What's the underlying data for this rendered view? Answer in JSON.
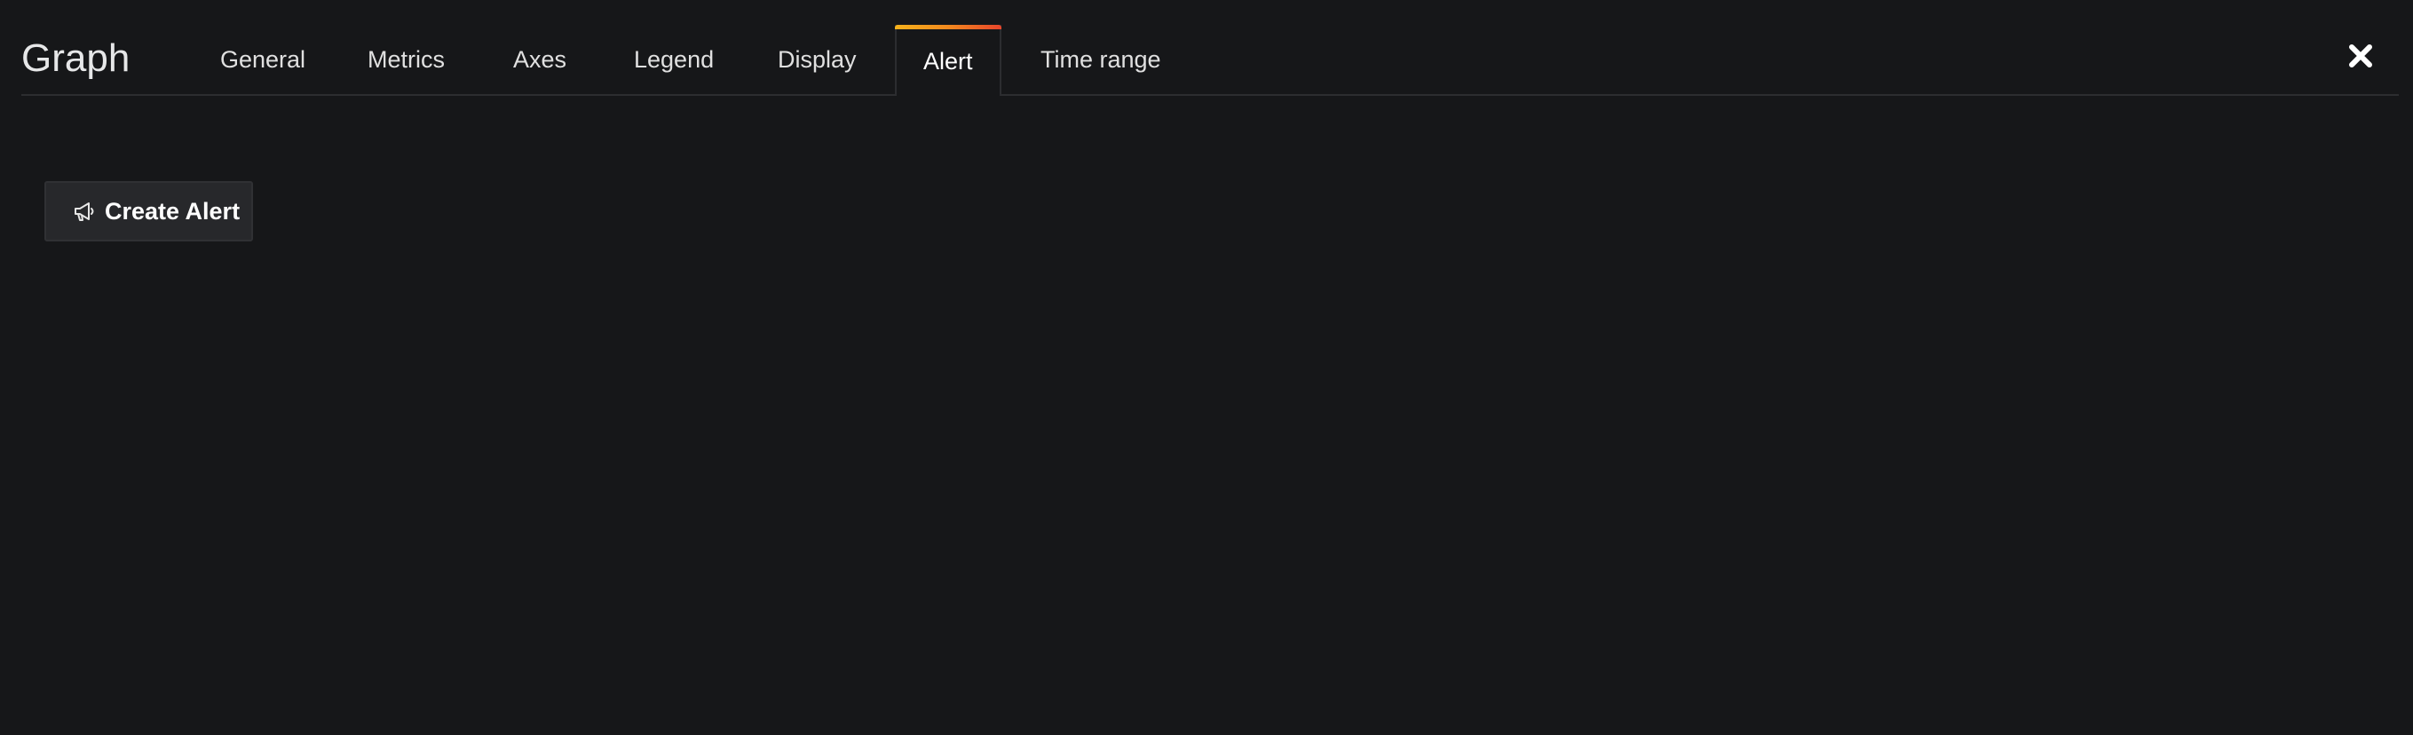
{
  "header": {
    "title": "Graph",
    "close_icon": "close-icon"
  },
  "tabs": [
    {
      "label": "General",
      "active": false
    },
    {
      "label": "Metrics",
      "active": false
    },
    {
      "label": "Axes",
      "active": false
    },
    {
      "label": "Legend",
      "active": false
    },
    {
      "label": "Display",
      "active": false
    },
    {
      "label": "Alert",
      "active": true
    },
    {
      "label": "Time range",
      "active": false
    }
  ],
  "alert": {
    "create_button_label": "Create Alert",
    "create_button_icon": "megaphone-icon"
  },
  "colors": {
    "background": "#161719",
    "active_tab_gradient": [
      "#f6b21b",
      "#f38a1e",
      "#e8452b"
    ],
    "button_background": "#27282b"
  }
}
